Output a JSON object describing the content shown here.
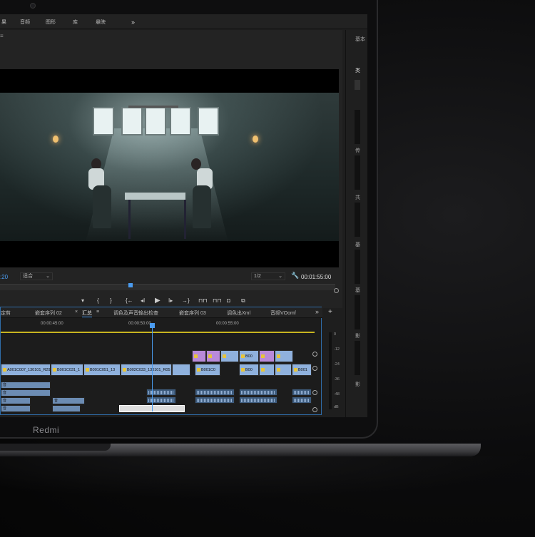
{
  "menu": {
    "items": [
      "果",
      "音频",
      "图形",
      "库",
      "悬映"
    ],
    "more": "»"
  },
  "monitor": {
    "panel_icon": "≡",
    "timecode_left": ":20",
    "fit_label": "适合",
    "resolution": "1/2",
    "timecode_right": "00:01:55:00"
  },
  "transport": {
    "mark_in": "▾",
    "bracket_in": "{",
    "bracket_out": "}",
    "go_in": "{←",
    "step_back": "◂I",
    "play": "▶",
    "step_fwd": "I▸",
    "go_out": "→}",
    "plus": "+"
  },
  "right_panel": {
    "title": "基本",
    "labels": [
      "类",
      "传",
      "共",
      "基",
      "基",
      "影",
      "影"
    ]
  },
  "timeline": {
    "tabs": [
      "定剪",
      "嵌套序列 02",
      "×",
      "汇总",
      "≡",
      "调色及声音输出检查",
      "嵌套序列 03",
      "调色出Xml",
      "音频VOomf",
      "»"
    ],
    "ruler": [
      "00:00:45:00",
      "00:00:50:00",
      "00:00:55:00"
    ],
    "video_clips": [
      "A001C007_130101_R29",
      "B001C031_1",
      "B001C051_13",
      "B002C033_130101_R05",
      "B001C0",
      "B00",
      "B001"
    ],
    "purple_clips": [
      "fx",
      "B00"
    ],
    "audio_labels": [
      "音",
      "音",
      "音",
      "音",
      "音"
    ]
  },
  "meter": {
    "scale": [
      "0",
      "-12",
      "-24",
      "-36",
      "-48",
      "dB"
    ]
  },
  "brand": "Redmi"
}
